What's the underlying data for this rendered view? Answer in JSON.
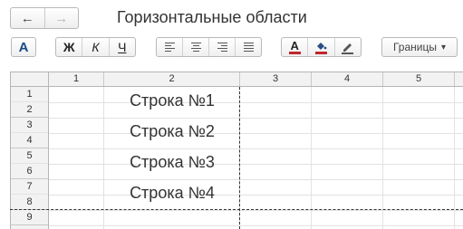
{
  "window": {
    "title": "Горизонтальные области"
  },
  "nav": {
    "back": "←",
    "forward": "→"
  },
  "toolbar": {
    "font_button": "A",
    "bold": "Ж",
    "italic": "К",
    "underline": "Ч",
    "text_color_letter": "A",
    "borders_label": "Границы",
    "borders_arrow": "▾",
    "accent_text_color": "#c0262d",
    "accent_fill_color": "#c0262d"
  },
  "sheet": {
    "columns": [
      "1",
      "2",
      "3",
      "4",
      "5"
    ],
    "rows": [
      "1",
      "2",
      "3",
      "4",
      "5",
      "6",
      "7",
      "8",
      "9"
    ],
    "cells": [
      "Строка №1",
      "Строка №2",
      "Строка №3",
      "Строка №4"
    ]
  }
}
